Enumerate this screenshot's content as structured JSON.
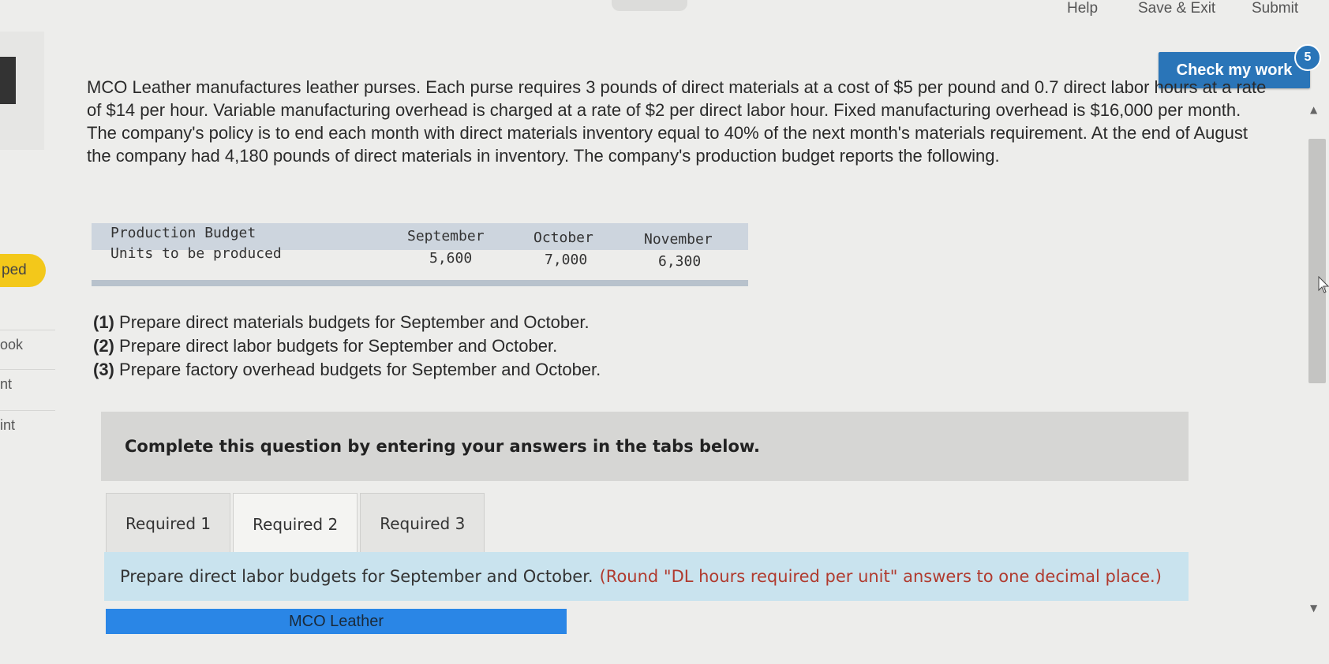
{
  "topbar": {
    "help": "Help",
    "save_exit": "Save & Exit",
    "submit": "Submit"
  },
  "check_work": {
    "label": "Check my work",
    "badge": "5"
  },
  "sidebar": {
    "pill": "ped",
    "items": [
      "ook",
      "nt",
      "int"
    ]
  },
  "problem_text": "MCO Leather manufactures leather purses. Each purse requires 3 pounds of direct materials at a cost of $5 per pound and 0.7 direct labor hours at a rate of $14 per hour. Variable manufacturing overhead is charged at a rate of $2 per direct labor hour. Fixed manufacturing overhead is $16,000 per month. The company's policy is to end each month with direct materials inventory equal to 40% of the next month's materials requirement. At the end of August the company had 4,180 pounds of direct materials in inventory. The company's production budget reports the following.",
  "production_budget": {
    "header": [
      "Production Budget",
      "September",
      "October",
      "November"
    ],
    "row": [
      "Units to be produced",
      "5,600",
      "7,000",
      "6,300"
    ]
  },
  "tasks": [
    {
      "num": "(1)",
      "text": "Prepare direct materials budgets for September and October."
    },
    {
      "num": "(2)",
      "text": "Prepare direct labor budgets for September and October."
    },
    {
      "num": "(3)",
      "text": "Prepare factory overhead budgets for September and October."
    }
  ],
  "complete_prompt": "Complete this question by entering your answers in the tabs below.",
  "tabs": [
    {
      "label": "Required 1",
      "active": false
    },
    {
      "label": "Required 2",
      "active": true
    },
    {
      "label": "Required 3",
      "active": false
    }
  ],
  "instruction": {
    "main": "Prepare direct labor budgets for September and October.",
    "note": "(Round \"DL hours required per unit\" answers to one decimal place.)"
  },
  "company_bar": "MCO Leather",
  "colors": {
    "accent_blue": "#2a75b8",
    "pill_yellow": "#f3c81a",
    "instruction_bg": "#c9e3ee",
    "note_red": "#b03a2e",
    "company_bar": "#2a86e6"
  }
}
